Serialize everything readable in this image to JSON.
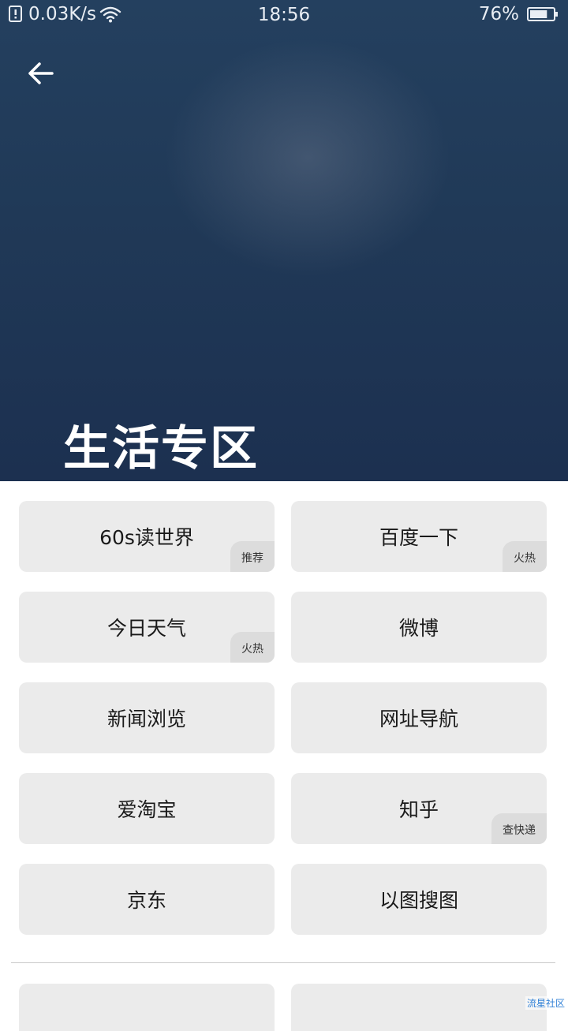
{
  "status_bar": {
    "net_speed": "0.03K/s",
    "time": "18:56",
    "battery": "76%",
    "battery_level": 0.76,
    "icons": [
      "sim-icon",
      "wifi-icon",
      "battery-icon"
    ]
  },
  "header": {
    "back_icon": "arrow-left-icon",
    "title": "生活专区"
  },
  "tiles": [
    {
      "label": "60s读世界",
      "badge": "推荐"
    },
    {
      "label": "百度一下",
      "badge": "火热"
    },
    {
      "label": "今日天气",
      "badge": "火热"
    },
    {
      "label": "微博",
      "badge": ""
    },
    {
      "label": "新闻浏览",
      "badge": ""
    },
    {
      "label": "网址导航",
      "badge": ""
    },
    {
      "label": "爱淘宝",
      "badge": ""
    },
    {
      "label": "知乎",
      "badge": "查快递"
    },
    {
      "label": "京东",
      "badge": ""
    },
    {
      "label": "以图搜图",
      "badge": ""
    }
  ],
  "watermark": "流星社区"
}
